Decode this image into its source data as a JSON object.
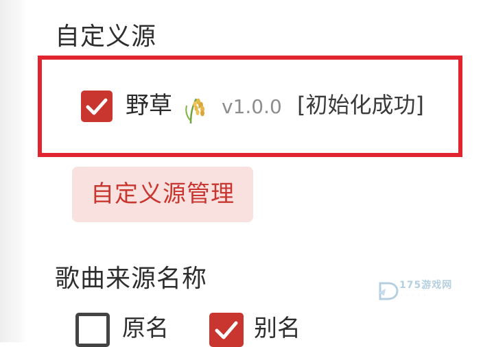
{
  "custom_source": {
    "section_title": "自定义源",
    "item": {
      "name": "野草",
      "icon": "rice-plant-icon",
      "version": "v1.0.0",
      "status": "[初始化成功]",
      "checked": true
    },
    "manage_button": "自定义源管理"
  },
  "song_source_name": {
    "section_title": "歌曲来源名称",
    "options": [
      {
        "label": "原名",
        "checked": false
      },
      {
        "label": "别名",
        "checked": true
      }
    ]
  },
  "watermark": {
    "text": "175游戏网"
  },
  "colors": {
    "accent": "#c8362f",
    "highlight_border": "#e0252e",
    "button_bg": "#f8e1df"
  }
}
